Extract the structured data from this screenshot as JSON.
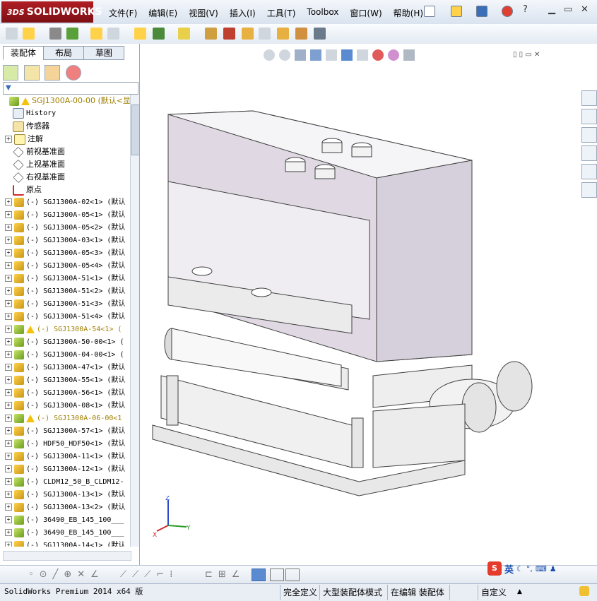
{
  "app": {
    "brand_prefix": "3DS",
    "brand": "SOLIDWORKS"
  },
  "menu": [
    "文件(F)",
    "编辑(E)",
    "视图(V)",
    "插入(I)",
    "工具(T)",
    "Toolbox",
    "窗口(W)",
    "帮助(H)"
  ],
  "left_panel": {
    "tabs": [
      "装配体",
      "布局",
      "草图"
    ],
    "active_tab": "装配体",
    "tree": [
      {
        "label": "SGJ1300A-00-00 (默认<显",
        "icon": "asm",
        "warn": true,
        "root": true
      },
      {
        "label": "History",
        "icon": "history"
      },
      {
        "label": "传感器",
        "icon": "sensor"
      },
      {
        "label": "注解",
        "icon": "annotation",
        "expand": true
      },
      {
        "label": "前视基准面",
        "icon": "plane"
      },
      {
        "label": "上视基准面",
        "icon": "plane"
      },
      {
        "label": "右视基准面",
        "icon": "plane"
      },
      {
        "label": "原点",
        "icon": "origin"
      },
      {
        "label": "(-) SGJ1300A-02<1> (默认",
        "icon": "part",
        "expand": true
      },
      {
        "label": "(-) SGJ1300A-05<1> (默认",
        "icon": "part",
        "expand": true
      },
      {
        "label": "(-) SGJ1300A-05<2> (默认",
        "icon": "part",
        "expand": true
      },
      {
        "label": "(-) SGJ1300A-03<1> (默认",
        "icon": "part",
        "expand": true
      },
      {
        "label": "(-) SGJ1300A-05<3> (默认",
        "icon": "part",
        "expand": true
      },
      {
        "label": "(-) SGJ1300A-05<4> (默认",
        "icon": "part",
        "expand": true
      },
      {
        "label": "(-) SGJ1300A-51<1> (默认",
        "icon": "part",
        "expand": true
      },
      {
        "label": "(-) SGJ1300A-51<2> (默认",
        "icon": "part",
        "expand": true
      },
      {
        "label": "(-) SGJ1300A-51<3> (默认",
        "icon": "part",
        "expand": true
      },
      {
        "label": "(-) SGJ1300A-51<4> (默认",
        "icon": "part",
        "expand": true
      },
      {
        "label": "(-) SGJ1300A-54<1> (",
        "icon": "asm",
        "warn": true,
        "expand": true
      },
      {
        "label": "(-) SGJ1300A-50-00<1> (",
        "icon": "asm",
        "expand": true
      },
      {
        "label": "(-) SGJ1300A-04-00<1> (",
        "icon": "asm",
        "expand": true
      },
      {
        "label": "(-) SGJ1300A-47<1> (默认",
        "icon": "part",
        "expand": true
      },
      {
        "label": "(-) SGJ1300A-55<1> (默认",
        "icon": "part",
        "expand": true
      },
      {
        "label": "(-) SGJ1300A-56<1> (默认",
        "icon": "part",
        "expand": true
      },
      {
        "label": "(-) SGJ1300A-08<1> (默认",
        "icon": "part",
        "expand": true
      },
      {
        "label": "(-) SGJ1300A-06-00<1",
        "icon": "asm",
        "warn": true,
        "expand": true
      },
      {
        "label": "(-) SGJ1300A-57<1> (默认",
        "icon": "part",
        "expand": true
      },
      {
        "label": "(-) HDF50_HDF50<1> (默认",
        "icon": "asm",
        "expand": true
      },
      {
        "label": "(-) SGJ1300A-11<1> (默认",
        "icon": "part",
        "expand": true
      },
      {
        "label": "(-) SGJ1300A-12<1> (默认",
        "icon": "part",
        "expand": true
      },
      {
        "label": "(-) CLDM12_50_B_CLDM12-",
        "icon": "asm",
        "expand": true
      },
      {
        "label": "(-) SGJ1300A-13<1> (默认",
        "icon": "part",
        "expand": true
      },
      {
        "label": "(-) SGJ1300A-13<2> (默认",
        "icon": "part",
        "expand": true
      },
      {
        "label": "(-) 36490_EB_145_100___",
        "icon": "asm",
        "expand": true
      },
      {
        "label": "(-) 36490_EB_145_100___",
        "icon": "asm",
        "expand": true
      },
      {
        "label": "(-) SGJ1300A-14<1> (默认",
        "icon": "part",
        "expand": true
      }
    ]
  },
  "status_bar": {
    "product": "SolidWorks Premium 2014 x64 版",
    "state": "完全定义",
    "mode": "大型装配体模式",
    "editing": "在编辑 装配体",
    "custom": "自定义"
  },
  "ime": {
    "mode": "英"
  },
  "triad": {
    "x": "X",
    "y": "Y",
    "z": "Z"
  },
  "colors": {
    "accent": "#b01e24",
    "model_panel": "#e0d9e4",
    "model_line": "#404040"
  }
}
